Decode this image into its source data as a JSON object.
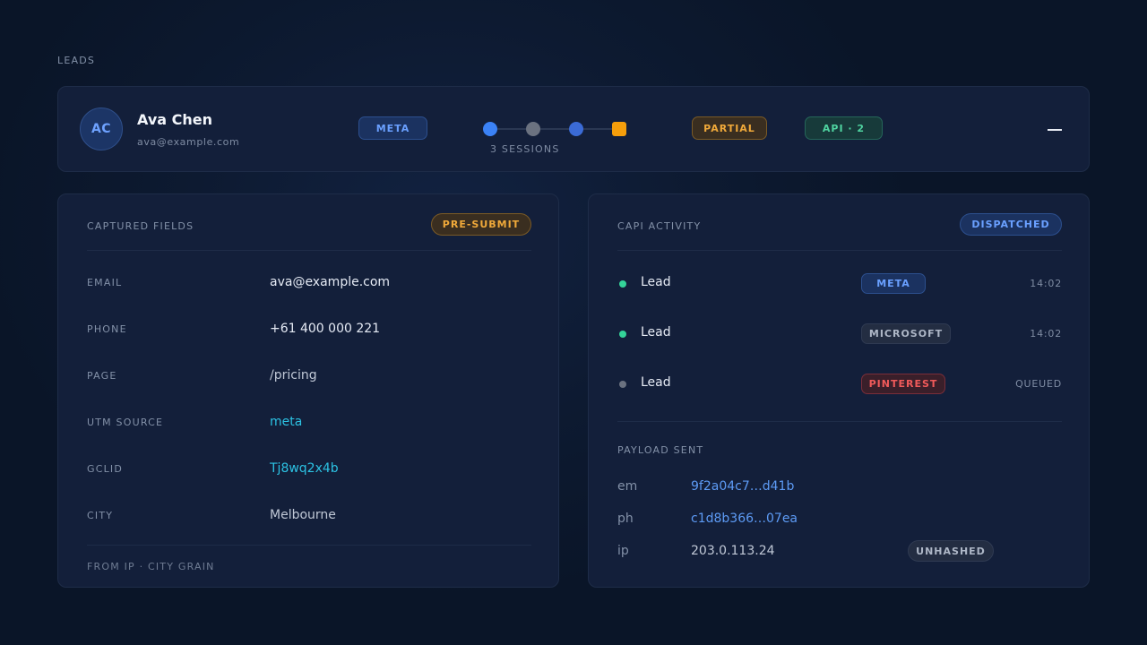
{
  "section_title": "LEADS",
  "lead": {
    "initials": "AC",
    "name": "Ava Chen",
    "email": "ava@example.com",
    "source_badge": "META",
    "sessions_label": "3 SESSIONS",
    "session_dots": [
      "#3b82f6",
      "#6b7280",
      "#3b6bd6",
      "#f59e0b"
    ],
    "status_badge": "PARTIAL",
    "api_badge": "API · 2"
  },
  "captured": {
    "title": "CAPTURED FIELDS",
    "badge": "PRE-SUBMIT",
    "fields": [
      {
        "label": "EMAIL",
        "value": "ava@example.com"
      },
      {
        "label": "PHONE",
        "value": "+61 400 000 221"
      },
      {
        "label": "PAGE",
        "value": "/pricing"
      },
      {
        "label": "UTM SOURCE",
        "value": "meta"
      },
      {
        "label": "GCLID",
        "value": "Tj8wq2x4b"
      },
      {
        "label": "CITY",
        "value": "Melbourne"
      }
    ],
    "footnote": "FROM IP · CITY GRAIN"
  },
  "capi": {
    "title": "CAPI ACTIVITY",
    "badge": "DISPATCHED",
    "events": [
      {
        "event": "Lead",
        "platform": "META",
        "time": "14:02",
        "status_color": "#34d399"
      },
      {
        "event": "Lead",
        "platform": "MICROSOFT",
        "time": "14:02",
        "status_color": "#34d399"
      },
      {
        "event": "Lead",
        "platform": "PINTEREST",
        "time": "QUEUED",
        "status_color": "#6b7280"
      }
    ],
    "payload": {
      "title": "PAYLOAD SENT",
      "rows": [
        {
          "key": "em",
          "value": "9f2a04c7…d41b"
        },
        {
          "key": "ph",
          "value": "c1d8b366…07ea"
        },
        {
          "key": "ip",
          "value": "203.0.113.24",
          "badge": "UNHASHED"
        }
      ]
    }
  }
}
